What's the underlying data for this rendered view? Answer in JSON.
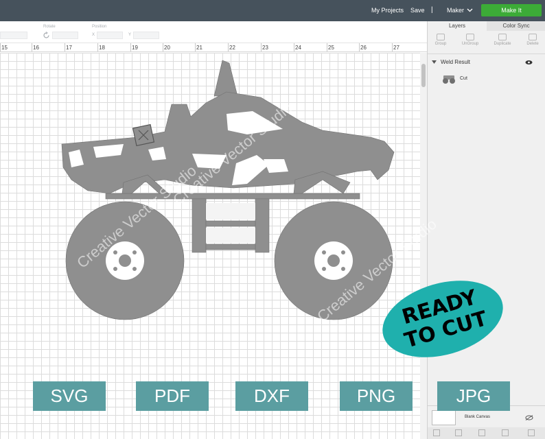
{
  "topbar": {
    "my_projects": "My Projects",
    "save": "Save",
    "separator": "|",
    "machine": "Maker",
    "make_it": "Make It"
  },
  "toolbar": {
    "rotate_label": "Rotate",
    "position_label": "Position",
    "x_label": "X",
    "y_label": "Y"
  },
  "ruler": {
    "ticks": [
      "15",
      "16",
      "17",
      "18",
      "19",
      "20",
      "21",
      "22",
      "23",
      "24",
      "25",
      "26",
      "27"
    ]
  },
  "panel": {
    "tabs": [
      "Layers",
      "Color Sync"
    ],
    "tools": [
      "Group",
      "UnGroup",
      "Duplicate",
      "Delete"
    ],
    "group_label": "Weld Result",
    "layer_label": "Cut",
    "blank_canvas": "Blank Canvas"
  },
  "badge": {
    "line1": "READY",
    "line2": "TO CUT"
  },
  "formats": [
    "SVG",
    "PDF",
    "DXF",
    "PNG",
    "JPG"
  ],
  "watermark": "Creative Vector Studio",
  "colors": {
    "topbar": "#46525c",
    "accent_green": "#3cab37",
    "truck": "#8f8f8f",
    "badge": "#1fb0ad",
    "format_button": "#5b9ea1"
  }
}
